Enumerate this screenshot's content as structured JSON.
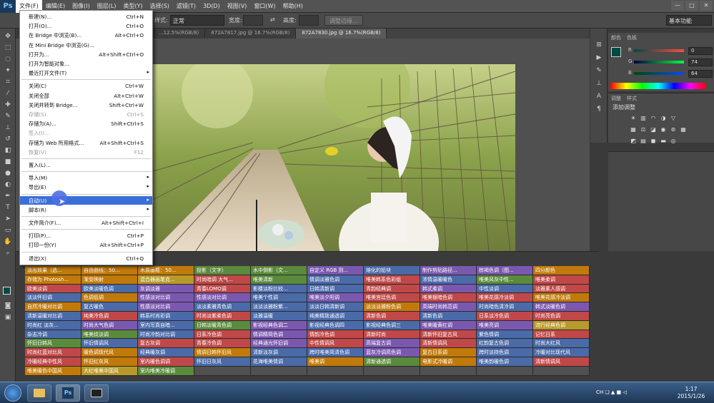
{
  "app": {
    "logo": "Ps"
  },
  "menubar": {
    "items": [
      "文件(F)",
      "编辑(E)",
      "图像(I)",
      "图层(L)",
      "类型(Y)",
      "选择(S)",
      "滤镜(T)",
      "3D(D)",
      "视图(V)",
      "窗口(W)",
      "帮助(H)"
    ],
    "window_buttons": [
      "—",
      "□",
      "✕"
    ]
  },
  "options": {
    "style_label": "样式:",
    "style_value": "正常",
    "width_label": "宽度:",
    "height_label": "高度:",
    "refine_edge": "调整边缘...",
    "workspace": "基本功能"
  },
  "tabs": [
    {
      "label": "...12.5%(RGB/8)",
      "active": false
    },
    {
      "label": "872A7817.jpg @ 16.7%(RGB/8)",
      "active": false
    },
    {
      "label": "872A7830.jpg @ 16.7%(RGB/8)",
      "active": true
    }
  ],
  "file_menu": [
    {
      "label": "新建(N)...",
      "shortcut": "Ctrl+N"
    },
    {
      "label": "打开(O)...",
      "shortcut": "Ctrl+O"
    },
    {
      "label": "在 Bridge 中浏览(B)...",
      "shortcut": "Alt+Ctrl+O"
    },
    {
      "label": "在 Mini Bridge 中浏览(G)...",
      "shortcut": ""
    },
    {
      "label": "打开为...",
      "shortcut": "Alt+Shift+Ctrl+O"
    },
    {
      "label": "打开为智能对象...",
      "shortcut": ""
    },
    {
      "label": "最近打开文件(T)",
      "shortcut": "",
      "submenu": true
    },
    {
      "sep": true
    },
    {
      "label": "关闭(C)",
      "shortcut": "Ctrl+W"
    },
    {
      "label": "关闭全部",
      "shortcut": "Alt+Ctrl+W"
    },
    {
      "label": "关闭并转到 Bridge...",
      "shortcut": "Shift+Ctrl+W"
    },
    {
      "label": "存储(S)",
      "shortcut": "Ctrl+S",
      "disabled": true
    },
    {
      "label": "存储为(A)...",
      "shortcut": "Shift+Ctrl+S"
    },
    {
      "label": "签入(I)...",
      "shortcut": "",
      "disabled": true
    },
    {
      "label": "存储为 Web 所用格式...",
      "shortcut": "Alt+Shift+Ctrl+S"
    },
    {
      "label": "恢复(V)",
      "shortcut": "F12",
      "disabled": true
    },
    {
      "sep": true
    },
    {
      "label": "置入(L)...",
      "shortcut": ""
    },
    {
      "sep": true
    },
    {
      "label": "导入(M)",
      "shortcut": "",
      "submenu": true
    },
    {
      "label": "导出(E)",
      "shortcut": "",
      "submenu": true
    },
    {
      "sep": true
    },
    {
      "label": "自动(U)",
      "shortcut": "",
      "submenu": true,
      "highlighted": true
    },
    {
      "label": "脚本(R)",
      "shortcut": "",
      "submenu": true
    },
    {
      "sep": true
    },
    {
      "label": "文件简介(F)...",
      "shortcut": "Alt+Shift+Ctrl+I"
    },
    {
      "sep": true
    },
    {
      "label": "打印(P)...",
      "shortcut": "Ctrl+P"
    },
    {
      "label": "打印一份(Y)",
      "shortcut": "Alt+Shift+Ctrl+P"
    },
    {
      "sep": true
    },
    {
      "label": "退出(X)",
      "shortcut": "Ctrl+Q"
    }
  ],
  "color_panel": {
    "tabs": [
      "颜色",
      "色板"
    ],
    "r_label": "R",
    "g_label": "G",
    "b_label": "B",
    "r": "0",
    "g": "74",
    "b": "64",
    "fg_color": "#004a40"
  },
  "adjustments_panel": {
    "tabs": [
      "调整",
      "样式"
    ],
    "title": "添加调整",
    "icons": [
      "brightness-icon",
      "levels-icon",
      "curves-icon",
      "exposure-icon",
      "vibrance-icon",
      "hue-sat-icon",
      "color-balance-icon",
      "bw-icon",
      "photo-filter-icon",
      "channel-mixer-icon",
      "color-lookup-icon",
      "invert-icon",
      "posterize-icon",
      "threshold-icon",
      "gradient-map-icon",
      "selective-color-icon"
    ]
  },
  "actions_grid": {
    "palette": {
      "o": "#c17a0a",
      "g": "#5a8a3c",
      "p": "#7b58b0",
      "r": "#c04848",
      "b": "#4a6aa8",
      "y": "#b89a2a",
      "k": "#505050"
    },
    "cells": [
      [
        "淡出效果（选...",
        "o"
      ],
      [
        "自由曲线：50...",
        "o"
      ],
      [
        "木质画框：50...",
        "o"
      ],
      [
        "投影（文字）",
        "g"
      ],
      [
        "水中倒影（文...",
        "g"
      ],
      [
        "自定义 RGB 到...",
        "p"
      ],
      [
        "熔化的铅块",
        "b"
      ],
      [
        "制作剪贴路径...",
        "p"
      ],
      [
        "棕褐色调（图...",
        "p"
      ],
      [
        "四分颜色",
        "o"
      ],
      [
        "存储为 Photosh...",
        "o"
      ],
      [
        "渐变映射",
        "o"
      ],
      [
        "混合器画笔克...",
        "y"
      ],
      [
        "时尚暗调 大气...",
        "r"
      ],
      [
        "唯美清新",
        "g"
      ],
      [
        "情调淡雅色调",
        "b"
      ],
      [
        "唯美韩系色彩组",
        "r"
      ],
      [
        "浓情温暖暖色",
        "b"
      ],
      [
        "唯美风灰中性...",
        "g"
      ],
      [
        "唯美柔调",
        "r"
      ],
      [
        "欧美淡调",
        "r"
      ],
      [
        "欧美淡暖色调",
        "b"
      ],
      [
        "灰调淡雅",
        "p"
      ],
      [
        "青春LOMO调",
        "r"
      ],
      [
        "影楼淡粉比较...",
        "b"
      ],
      [
        "日韩清新调",
        "b"
      ],
      [
        "青韵经典调",
        "r"
      ],
      [
        "韩式柔调",
        "p"
      ],
      [
        "中性淡调",
        "b"
      ],
      [
        "淡雅素人感调",
        "r"
      ],
      [
        "淡淡怀旧调",
        "b"
      ],
      [
        "色调低调",
        "o"
      ],
      [
        "性感淡对比调",
        "p"
      ],
      [
        "性感淡对比调",
        "p"
      ],
      [
        "唯美个性调",
        "b"
      ],
      [
        "唯美淡夕阳调",
        "p"
      ],
      [
        "唯美宫廷色调",
        "r"
      ],
      [
        "唯美银暗色调",
        "r"
      ],
      [
        "唯美花感冷淡调",
        "r"
      ],
      [
        "唯美花感冷淡调",
        "o"
      ],
      [
        "自然冷暖对比调",
        "o"
      ],
      [
        "复古暖色",
        "b"
      ],
      [
        "性感淡对比调",
        "p"
      ],
      [
        "淡淡素雅青色调",
        "b"
      ],
      [
        "淡淡淡雅粉紫...",
        "b"
      ],
      [
        "淡淡日韩清新调",
        "b"
      ],
      [
        "淡淡淡雅粉色调",
        "o"
      ],
      [
        "高端时尚韩范调",
        "p"
      ],
      [
        "时尚暗色清冷调",
        "b"
      ],
      [
        "韩式淡暖色调",
        "p"
      ],
      [
        "清新温暖对比调",
        "b"
      ],
      [
        "纯美冷色调",
        "r"
      ],
      [
        "韩系时尚彩调",
        "b"
      ],
      [
        "时尚淡紫柔色调",
        "r"
      ],
      [
        "淡雅温暖",
        "b"
      ],
      [
        "纯美精致通透调",
        "b"
      ],
      [
        "清新色调",
        "r"
      ],
      [
        "清新色调",
        "b"
      ],
      [
        "日系淡冷色调",
        "r"
      ],
      [
        "时尚亮色调",
        "r"
      ],
      [
        "时尚红 淡灰...",
        "b"
      ],
      [
        "时尚大气色调",
        "p"
      ],
      [
        "室内写真自暗...",
        "b"
      ],
      [
        "日韩淡暖青色调",
        "g"
      ],
      [
        "影视经典色调二",
        "p"
      ],
      [
        "影视经典色调四",
        "b"
      ],
      [
        "影视经典色调三",
        "b"
      ],
      [
        "唯美暖黄红调",
        "p"
      ],
      [
        "唯美亮调",
        "p"
      ],
      [
        "流行经典色调",
        "y"
      ],
      [
        "杂志冷调",
        "b"
      ],
      [
        "唯美纹淡调",
        "g"
      ],
      [
        "时尚冷韵对比调",
        "b"
      ],
      [
        "日系冷色调",
        "r"
      ],
      [
        "情调精简色调",
        "p"
      ],
      [
        "情韵冷色调",
        "r"
      ],
      [
        "清新时尚",
        "r"
      ],
      [
        "清新怀旧复古风",
        "r"
      ],
      [
        "紫色情调",
        "b"
      ],
      [
        "记忆日系",
        "r"
      ],
      [
        "怀旧日韩风",
        "g"
      ],
      [
        "怀旧情调风",
        "b"
      ],
      [
        "复古灰调",
        "r"
      ],
      [
        "青春冷色调",
        "r"
      ],
      [
        "经典通光怀旧调",
        "p"
      ],
      [
        "中性情调风",
        "r"
      ],
      [
        "高端复古调",
        "p"
      ],
      [
        "清新情调风",
        "r"
      ],
      [
        "红韵复古色调",
        "b"
      ],
      [
        "时尚大红风",
        "b"
      ],
      [
        "时尚红蓝对比风",
        "r"
      ],
      [
        "暖色调现代风",
        "o"
      ],
      [
        "经典暖灰调",
        "b"
      ],
      [
        "情调日韩怀旧风",
        "o"
      ],
      [
        "清新淡灰调",
        "b"
      ],
      [
        "跨时唯美简清色调",
        "b"
      ],
      [
        "蓝灰冷调高色调",
        "p"
      ],
      [
        "复古日系调",
        "o"
      ],
      [
        "跨时淡持色调",
        "b"
      ],
      [
        "冷暖对比现代风",
        "b"
      ],
      [
        "冷暖经典中性风",
        "r"
      ],
      [
        "怀旧红灰风",
        "o"
      ],
      [
        "室内暖色调调",
        "r"
      ],
      [
        "怀旧日灰风",
        "b"
      ],
      [
        "花海唯美情调",
        "b"
      ],
      [
        "唯美调",
        "o"
      ],
      [
        "清新通透调",
        "g"
      ],
      [
        "电影式冷暖调",
        "o"
      ],
      [
        "唯美韵暖色调",
        "b"
      ],
      [
        "清新情调风",
        "r"
      ],
      [
        "唯美暖色中国风",
        "o"
      ],
      [
        "大红唯美中国风",
        "y"
      ],
      [
        "室内唯美冷暖调",
        "g"
      ],
      [
        "",
        "k"
      ],
      [
        "",
        "k"
      ],
      [
        "",
        "k"
      ],
      [
        "",
        "k"
      ],
      [
        "",
        "k"
      ],
      [
        "",
        "k"
      ],
      [
        "",
        "k"
      ]
    ]
  },
  "taskbar": {
    "time": "1:17",
    "date": "2015/1/26",
    "tray": "CH ❏ ▲ ■ ◁"
  }
}
